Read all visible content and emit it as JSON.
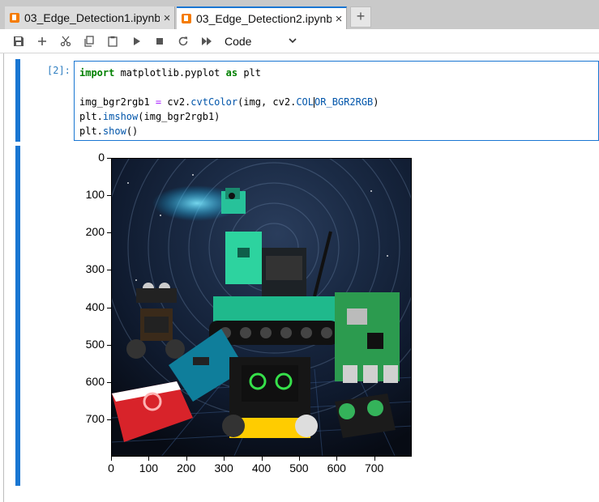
{
  "tabs": [
    {
      "label": "03_Edge_Detection1.ipynb",
      "active": false
    },
    {
      "label": "03_Edge_Detection2.ipynb",
      "active": true
    }
  ],
  "tab_close_glyph": "×",
  "new_tab_glyph": "+",
  "toolbar": {
    "icons": [
      "save-icon",
      "add-icon",
      "cut-icon",
      "copy-icon",
      "paste-icon",
      "run-icon",
      "stop-icon",
      "restart-icon",
      "fast-forward-icon"
    ],
    "cell_type": "Code"
  },
  "cell": {
    "prompt": "[2]:",
    "code_lines": [
      "import matplotlib.pyplot as plt",
      "",
      "img_bgr2rgb1 = cv2.cvtColor(img, cv2.COLOR_BGR2RGB)",
      "plt.imshow(img_bgr2rgb1)",
      "plt.show()"
    ]
  },
  "chart_data": {
    "type": "image",
    "title": "",
    "xlabel": "",
    "ylabel": "",
    "xlim": [
      0,
      800
    ],
    "ylim": [
      800,
      0
    ],
    "xticks": [
      "0",
      "100",
      "200",
      "300",
      "400",
      "500",
      "600",
      "700"
    ],
    "yticks": [
      "0",
      "100",
      "200",
      "300",
      "400",
      "500",
      "600",
      "700"
    ]
  },
  "colors": {
    "accent": "#1976d2",
    "notebook_icon": "#f57c00"
  }
}
